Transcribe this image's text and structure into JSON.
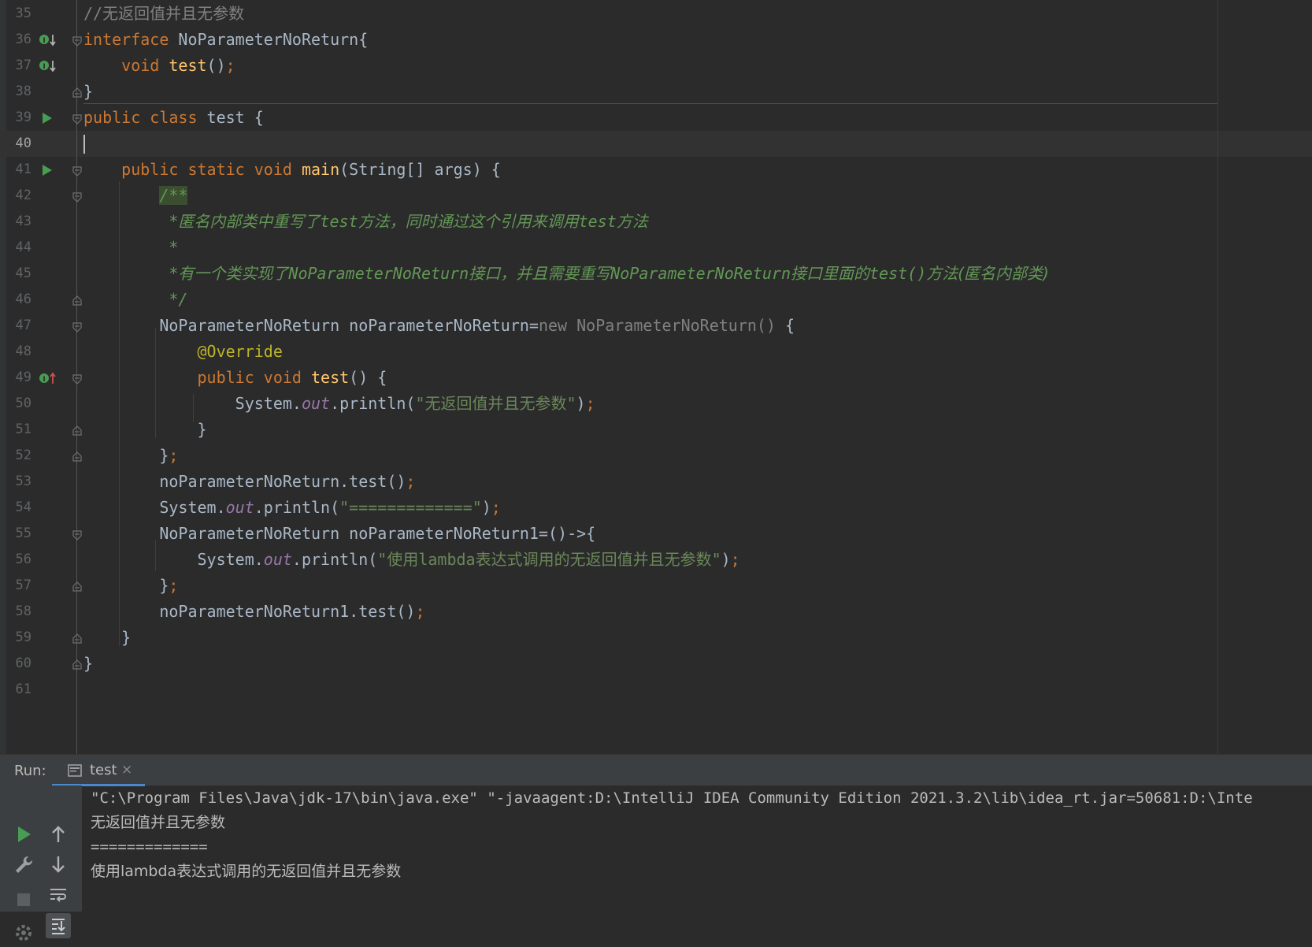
{
  "editor": {
    "lines": [
      {
        "num": "35",
        "parts": [
          {
            "t": "//",
            "c": "lc"
          },
          {
            "t": "无返回值并且无参数",
            "c": "lc cn"
          }
        ]
      },
      {
        "num": "36",
        "parts": [
          {
            "t": "interface ",
            "c": "kw"
          },
          {
            "t": "NoParameterNoReturn{",
            "c": ""
          }
        ]
      },
      {
        "num": "37",
        "parts": [
          {
            "t": "    void ",
            "c": "kw"
          },
          {
            "t": "test",
            "c": "fn"
          },
          {
            "t": "()",
            "c": ""
          },
          {
            "t": ";",
            "c": "sc"
          }
        ]
      },
      {
        "num": "38",
        "parts": [
          {
            "t": "}",
            "c": ""
          }
        ]
      },
      {
        "num": "39",
        "parts": [
          {
            "t": "public class ",
            "c": "kw"
          },
          {
            "t": "test {",
            "c": ""
          }
        ]
      },
      {
        "num": "40",
        "parts": []
      },
      {
        "num": "41",
        "parts": [
          {
            "t": "    public static void ",
            "c": "kw"
          },
          {
            "t": "main",
            "c": "fn"
          },
          {
            "t": "(String[] args) {",
            "c": ""
          }
        ]
      },
      {
        "num": "42",
        "parts": [
          {
            "t": "        ",
            "c": ""
          },
          {
            "t": "/**",
            "c": "doc hl"
          }
        ]
      },
      {
        "num": "43",
        "parts": [
          {
            "t": "         *",
            "c": "doc"
          },
          {
            "t": "匿名内部类中重写了",
            "c": "doc cn"
          },
          {
            "t": "test",
            "c": "doc"
          },
          {
            "t": "方法，同时通过这个引用来调用",
            "c": "doc cn"
          },
          {
            "t": "test",
            "c": "doc"
          },
          {
            "t": "方法",
            "c": "doc cn"
          }
        ]
      },
      {
        "num": "44",
        "parts": [
          {
            "t": "         *",
            "c": "doc"
          }
        ]
      },
      {
        "num": "45",
        "parts": [
          {
            "t": "         *",
            "c": "doc"
          },
          {
            "t": "有一个类实现了",
            "c": "doc cn"
          },
          {
            "t": "NoParameterNoReturn",
            "c": "doc"
          },
          {
            "t": "接口，并且需要重写",
            "c": "doc cn"
          },
          {
            "t": "NoParameterNoReturn",
            "c": "doc"
          },
          {
            "t": "接口里面的",
            "c": "doc cn"
          },
          {
            "t": "test()",
            "c": "doc"
          },
          {
            "t": "方法(匿名内部类)",
            "c": "doc cn"
          }
        ]
      },
      {
        "num": "46",
        "parts": [
          {
            "t": "         */",
            "c": "doc"
          }
        ]
      },
      {
        "num": "47",
        "parts": [
          {
            "t": "        NoParameterNoReturn noParameterNoReturn=",
            "c": ""
          },
          {
            "t": "new NoParameterNoReturn()",
            "c": "gray"
          },
          {
            "t": " {",
            "c": ""
          }
        ]
      },
      {
        "num": "48",
        "parts": [
          {
            "t": "            @Override",
            "c": "ann"
          }
        ]
      },
      {
        "num": "49",
        "parts": [
          {
            "t": "            public void ",
            "c": "kw"
          },
          {
            "t": "test",
            "c": "fn"
          },
          {
            "t": "() {",
            "c": ""
          }
        ]
      },
      {
        "num": "50",
        "parts": [
          {
            "t": "                System.",
            "c": ""
          },
          {
            "t": "out",
            "c": "fld"
          },
          {
            "t": ".println(",
            "c": ""
          },
          {
            "t": "\"",
            "c": "str"
          },
          {
            "t": "无返回值并且无参数",
            "c": "str cn"
          },
          {
            "t": "\"",
            "c": "str"
          },
          {
            "t": ")",
            "c": ""
          },
          {
            "t": ";",
            "c": "sc"
          }
        ]
      },
      {
        "num": "51",
        "parts": [
          {
            "t": "            }",
            "c": ""
          }
        ]
      },
      {
        "num": "52",
        "parts": [
          {
            "t": "        }",
            "c": ""
          },
          {
            "t": ";",
            "c": "sc"
          }
        ]
      },
      {
        "num": "53",
        "parts": [
          {
            "t": "        noParameterNoReturn.test()",
            "c": ""
          },
          {
            "t": ";",
            "c": "sc"
          }
        ]
      },
      {
        "num": "54",
        "parts": [
          {
            "t": "        System.",
            "c": ""
          },
          {
            "t": "out",
            "c": "fld"
          },
          {
            "t": ".println(",
            "c": ""
          },
          {
            "t": "\"=============\"",
            "c": "str"
          },
          {
            "t": ")",
            "c": ""
          },
          {
            "t": ";",
            "c": "sc"
          }
        ]
      },
      {
        "num": "55",
        "parts": [
          {
            "t": "        NoParameterNoReturn noParameterNoReturn1=()->{",
            "c": ""
          }
        ]
      },
      {
        "num": "56",
        "parts": [
          {
            "t": "            System.",
            "c": ""
          },
          {
            "t": "out",
            "c": "fld"
          },
          {
            "t": ".println(",
            "c": ""
          },
          {
            "t": "\"",
            "c": "str"
          },
          {
            "t": "使用",
            "c": "str cn"
          },
          {
            "t": "lambda",
            "c": "str"
          },
          {
            "t": "表达式调用的无返回值并且无参数",
            "c": "str cn"
          },
          {
            "t": "\"",
            "c": "str"
          },
          {
            "t": ")",
            "c": ""
          },
          {
            "t": ";",
            "c": "sc"
          }
        ]
      },
      {
        "num": "57",
        "parts": [
          {
            "t": "        }",
            "c": ""
          },
          {
            "t": ";",
            "c": "sc"
          }
        ]
      },
      {
        "num": "58",
        "parts": [
          {
            "t": "        noParameterNoReturn1.test()",
            "c": ""
          },
          {
            "t": ";",
            "c": "sc"
          }
        ]
      },
      {
        "num": "59",
        "parts": [
          {
            "t": "    }",
            "c": ""
          }
        ]
      },
      {
        "num": "60",
        "parts": [
          {
            "t": "}",
            "c": ""
          }
        ]
      },
      {
        "num": "61",
        "parts": []
      }
    ]
  },
  "run": {
    "title": "Run:",
    "tab_label": "test",
    "tab_close": "×",
    "output": [
      "\"C:\\Program Files\\Java\\jdk-17\\bin\\java.exe\" \"-javaagent:D:\\IntelliJ IDEA Community Edition 2021.3.2\\lib\\idea_rt.jar=50681:D:\\Inte",
      "无返回值并且无参数",
      "=============",
      "使用lambda表达式调用的无返回值并且无参数"
    ]
  },
  "colors": {
    "background": "#2b2b2b",
    "keyword": "#cc7832",
    "method": "#ffc66d",
    "doc_comment": "#629755",
    "string": "#6a8759",
    "field": "#9876aa",
    "annotation": "#bbb529",
    "tab_underline": "#4a88c7"
  },
  "icons": {
    "gutter_36": "implemented-down-icon",
    "gutter_37": "implemented-down-icon",
    "gutter_39": "run-gutter-icon",
    "gutter_41": "run-gutter-icon",
    "gutter_49": "implements-up-icon",
    "toolbar": [
      "rerun-icon",
      "wrench-icon",
      "stop-icon",
      "settings-icon",
      "scroll-up-icon",
      "scroll-down-icon",
      "soft-wrap-icon",
      "scroll-to-end-icon"
    ]
  }
}
